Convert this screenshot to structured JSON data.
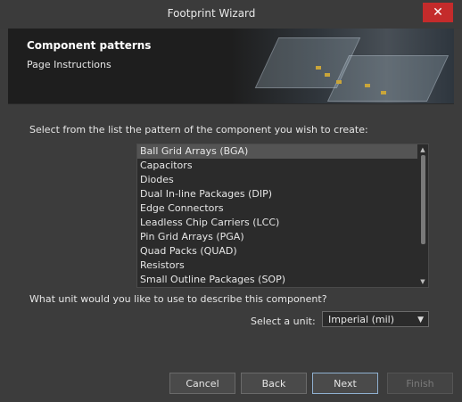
{
  "window": {
    "title": "Footprint Wizard",
    "close_glyph": "✕"
  },
  "banner": {
    "heading": "Component patterns",
    "subheading": "Page Instructions"
  },
  "page": {
    "prompt": "Select from the list the pattern of the component you wish to create:",
    "patterns": [
      "Ball Grid Arrays (BGA)",
      "Capacitors",
      "Diodes",
      "Dual In-line Packages (DIP)",
      "Edge Connectors",
      "Leadless Chip Carriers (LCC)",
      "Pin Grid Arrays (PGA)",
      "Quad Packs (QUAD)",
      "Resistors",
      "Small Outline Packages (SOP)"
    ],
    "selected_index": 0,
    "unit_question": "What unit would you like to use to describe this component?",
    "unit_label": "Select a unit:",
    "unit_value": "Imperial (mil)"
  },
  "buttons": {
    "cancel": "Cancel",
    "back": "Back",
    "next": "Next",
    "finish": "Finish"
  }
}
